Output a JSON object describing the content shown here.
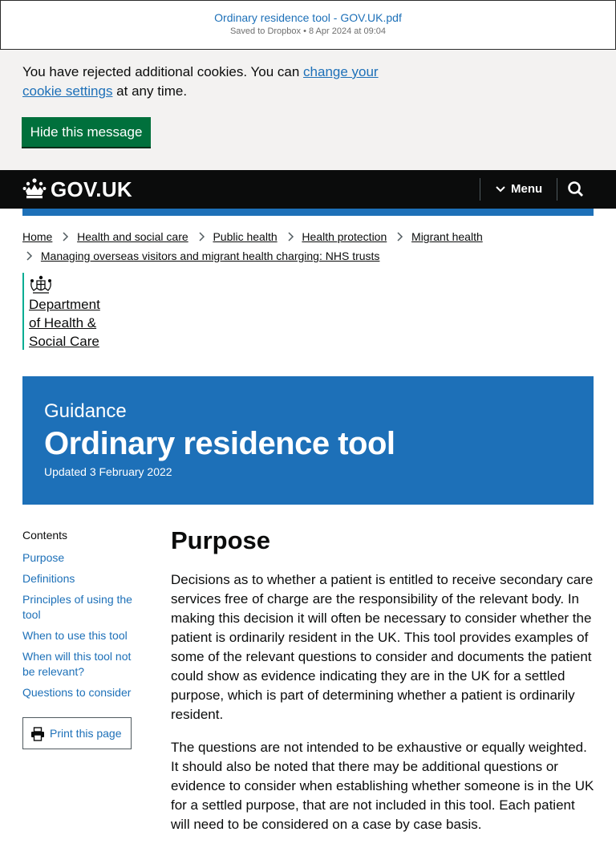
{
  "pdf_bar": {
    "title": "Ordinary residence tool - GOV.UK.pdf",
    "subtitle": "Saved to Dropbox • 8 Apr 2024 at 09:04"
  },
  "cookie_banner": {
    "text_before": "You have rejected additional cookies. You can ",
    "link": "change your cookie settings",
    "text_after": " at any time.",
    "hide_button": "Hide this message"
  },
  "header": {
    "logo": "GOV.UK",
    "menu_label": "Menu",
    "colors": {
      "background": "#0b0c0c",
      "accent": "#1d70b8"
    }
  },
  "breadcrumbs": [
    "Home",
    "Health and social care",
    "Public health",
    "Health protection",
    "Migrant health",
    "Managing overseas visitors and migrant health charging: NHS trusts"
  ],
  "organisation": {
    "name_line1": "Department",
    "name_line2": "of Health &",
    "name_line3": "Social Care"
  },
  "hero": {
    "caption": "Guidance",
    "title": "Ordinary residence tool",
    "updated": "Updated 3 February 2022"
  },
  "contents": {
    "heading": "Contents",
    "items": [
      "Purpose",
      "Definitions",
      "Principles of using the tool",
      "When to use this tool",
      "When will this tool not be relevant?",
      "Questions to consider"
    ],
    "print_label": "Print this page"
  },
  "main": {
    "heading": "Purpose",
    "paragraphs": [
      "Decisions as to whether a patient is entitled to receive secondary care services free of charge are the responsibility of the relevant body. In making this decision it will often be necessary to consider whether the patient is ordinarily resident in the UK. This tool provides examples of some of the relevant questions to consider and documents the patient could show as evidence indicating they are in the UK for a settled purpose, which is part of determining whether a patient is ordinarily resident.",
      "The questions are not intended to be exhaustive or equally weighted. It should also be noted that there may be additional questions or evidence to consider when establishing whether someone is in the UK for a settled purpose, that are not included in this tool. Each patient will need to be considered on a case by case basis."
    ]
  }
}
